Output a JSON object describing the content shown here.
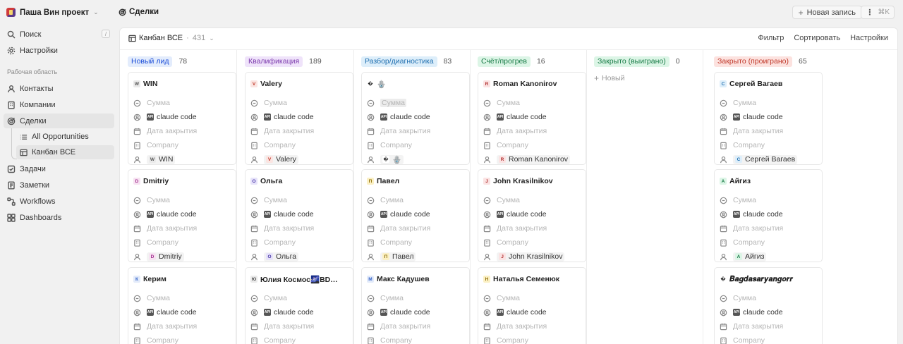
{
  "workspace": {
    "name": "Паша Вин проект",
    "chevron": "⌄"
  },
  "sidebar": {
    "search": {
      "label": "Поиск",
      "shortcut": "/"
    },
    "settings": {
      "label": "Настройки"
    },
    "section_label": "Рабочая область",
    "items": [
      {
        "label": "Контакты",
        "icon": "user-icon"
      },
      {
        "label": "Компании",
        "icon": "building-icon"
      },
      {
        "label": "Сделки",
        "icon": "target-icon"
      },
      {
        "label": "All Opportunities",
        "icon": "list-icon"
      },
      {
        "label": "Канбан ВСЕ",
        "icon": "table-icon"
      },
      {
        "label": "Задачи",
        "icon": "checkbox-icon"
      },
      {
        "label": "Заметки",
        "icon": "note-icon"
      },
      {
        "label": "Workflows",
        "icon": "workflow-icon"
      },
      {
        "label": "Dashboards",
        "icon": "dashboard-icon"
      }
    ]
  },
  "header": {
    "title": "Сделки",
    "new_record": "Новая запись",
    "shortcut": "⌘K"
  },
  "view": {
    "name": "Канбан ВСЕ",
    "separator": "·",
    "count": "431",
    "chevron": "⌄",
    "actions": {
      "filter": "Фильтр",
      "sort": "Сортировать",
      "options": "Настройки"
    }
  },
  "placeholders": {
    "amount": "Сумма",
    "close_date": "Дата закрытия",
    "company": "Company",
    "owner": "claude code",
    "owner_badge": "API",
    "new": "Новый"
  },
  "columns": [
    {
      "label": "Новый лид",
      "count": "78",
      "color": "#1d4ed8",
      "bg": "#e3ecfc",
      "cards": [
        {
          "name": "WIN",
          "avatar": "W",
          "avatar_color": "#555",
          "avatar_bg": "#eaeaea"
        },
        {
          "name": "Dmitriy",
          "avatar": "D",
          "avatar_color": "#a12c8e",
          "avatar_bg": "#f7e3f2"
        },
        {
          "name": "Керим",
          "avatar": "К",
          "avatar_color": "#2f5fc7",
          "avatar_bg": "#e3ebfa"
        }
      ]
    },
    {
      "label": "Квалификация",
      "count": "189",
      "color": "#7c3aad",
      "bg": "#efe3fa",
      "cards": [
        {
          "name": "Valery",
          "avatar": "V",
          "avatar_color": "#c0392b",
          "avatar_bg": "#fbe5e2"
        },
        {
          "name": "Ольга",
          "avatar": "О",
          "avatar_color": "#4b3aa8",
          "avatar_bg": "#e7e3fa"
        },
        {
          "name": "Юлия Космос🌌BD…",
          "avatar": "Ю",
          "avatar_color": "#555",
          "avatar_bg": "#eaeaea"
        }
      ]
    },
    {
      "label": "Разбор/диагностика",
      "count": "83",
      "color": "#1f6fb0",
      "bg": "#ddeefa",
      "cards": [
        {
          "name": "🪬",
          "avatar": "�",
          "avatar_color": "#222",
          "avatar_bg": "#ffffff"
        },
        {
          "name": "Павел",
          "avatar": "П",
          "avatar_color": "#8a6a00",
          "avatar_bg": "#fbf0c4"
        },
        {
          "name": "Макс Кадушев",
          "avatar": "М",
          "avatar_color": "#2f5fc7",
          "avatar_bg": "#e3ebfa"
        }
      ]
    },
    {
      "label": "Счёт/прогрев",
      "count": "16",
      "color": "#167a45",
      "bg": "#dcf5e6",
      "cards": [
        {
          "name": "Roman Kanonirov",
          "avatar": "R",
          "avatar_color": "#b03030",
          "avatar_bg": "#fbe3e3"
        },
        {
          "name": "John Krasilnikov",
          "avatar": "J",
          "avatar_color": "#b03030",
          "avatar_bg": "#fbe3e3"
        },
        {
          "name": "Наталья Семенюк",
          "avatar": "Н",
          "avatar_color": "#8a6a00",
          "avatar_bg": "#fbf0c4"
        }
      ]
    },
    {
      "label": "Закрыто (выиграно)",
      "count": "0",
      "color": "#167a45",
      "bg": "#dcf5e6",
      "cards": []
    },
    {
      "label": "Закрыто (проиграно)",
      "count": "65",
      "color": "#c0392b",
      "bg": "#fce2df",
      "cards": [
        {
          "name": "Сергей Вагаев",
          "avatar": "С",
          "avatar_color": "#1f6fb0",
          "avatar_bg": "#ddeefa"
        },
        {
          "name": "Айгиз",
          "avatar": "А",
          "avatar_color": "#167a45",
          "avatar_bg": "#dcf5e6"
        },
        {
          "name": "𝑩𝒂𝒈𝒅𝒂𝒔𝒂𝒓𝒚𝒂𝒏𝒈𝒐𝒓𝒓",
          "avatar": "�",
          "avatar_color": "#222",
          "avatar_bg": "#ffffff"
        }
      ]
    }
  ]
}
